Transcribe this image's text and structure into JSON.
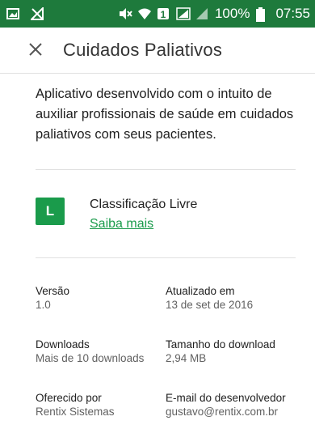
{
  "status_bar": {
    "battery_text": "100%",
    "time": "07:55"
  },
  "app_bar": {
    "title": "Cuidados Paliativos"
  },
  "description": "Aplicativo desenvolvido com o intuito de auxiliar profissionais de saúde em cuidados paliativos com seus pacientes.",
  "rating": {
    "badge_letter": "L",
    "title": "Classificação Livre",
    "link": "Saiba mais",
    "badge_color": "#1a9b4b"
  },
  "info": {
    "version_label": "Versão",
    "version_value": "1.0",
    "updated_label": "Atualizado em",
    "updated_value": "13 de set de 2016",
    "downloads_label": "Downloads",
    "downloads_value": "Mais de 10 downloads",
    "size_label": "Tamanho do download",
    "size_value": "2,94 MB",
    "offered_label": "Oferecido por",
    "offered_value": "Rentix Sistemas",
    "email_label": "E-mail do desenvolvedor",
    "email_value": "gustavo@rentix.com.br"
  },
  "colors": {
    "status_bar": "#1e7a3c",
    "accent": "#1a9b4b"
  },
  "icons": [
    "image-notification-icon",
    "signal-off-icon",
    "mute-icon",
    "wifi-icon",
    "sim-1-icon",
    "signal-icon",
    "battery-icon",
    "close-icon"
  ]
}
